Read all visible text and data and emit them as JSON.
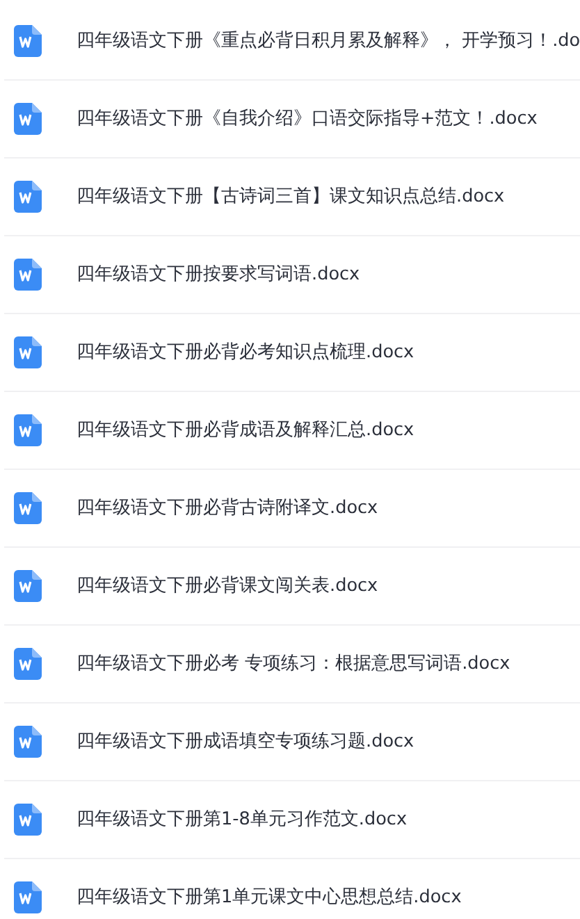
{
  "files": [
    {
      "name": "四年级语文下册《重点必背日积月累及解释》， 开学预习！.do"
    },
    {
      "name": "四年级语文下册《自我介绍》口语交际指导+范文！.docx"
    },
    {
      "name": "四年级语文下册【古诗词三首】课文知识点总结.docx"
    },
    {
      "name": "四年级语文下册按要求写词语.docx"
    },
    {
      "name": "四年级语文下册必背必考知识点梳理.docx"
    },
    {
      "name": "四年级语文下册必背成语及解释汇总.docx"
    },
    {
      "name": "四年级语文下册必背古诗附译文.docx"
    },
    {
      "name": "四年级语文下册必背课文闯关表.docx"
    },
    {
      "name": "四年级语文下册必考 专项练习：根据意思写词语.docx"
    },
    {
      "name": "四年级语文下册成语填空专项练习题.docx"
    },
    {
      "name": "四年级语文下册第1-8单元习作范文.docx"
    },
    {
      "name": "四年级语文下册第1单元课文中心思想总结.docx"
    }
  ]
}
